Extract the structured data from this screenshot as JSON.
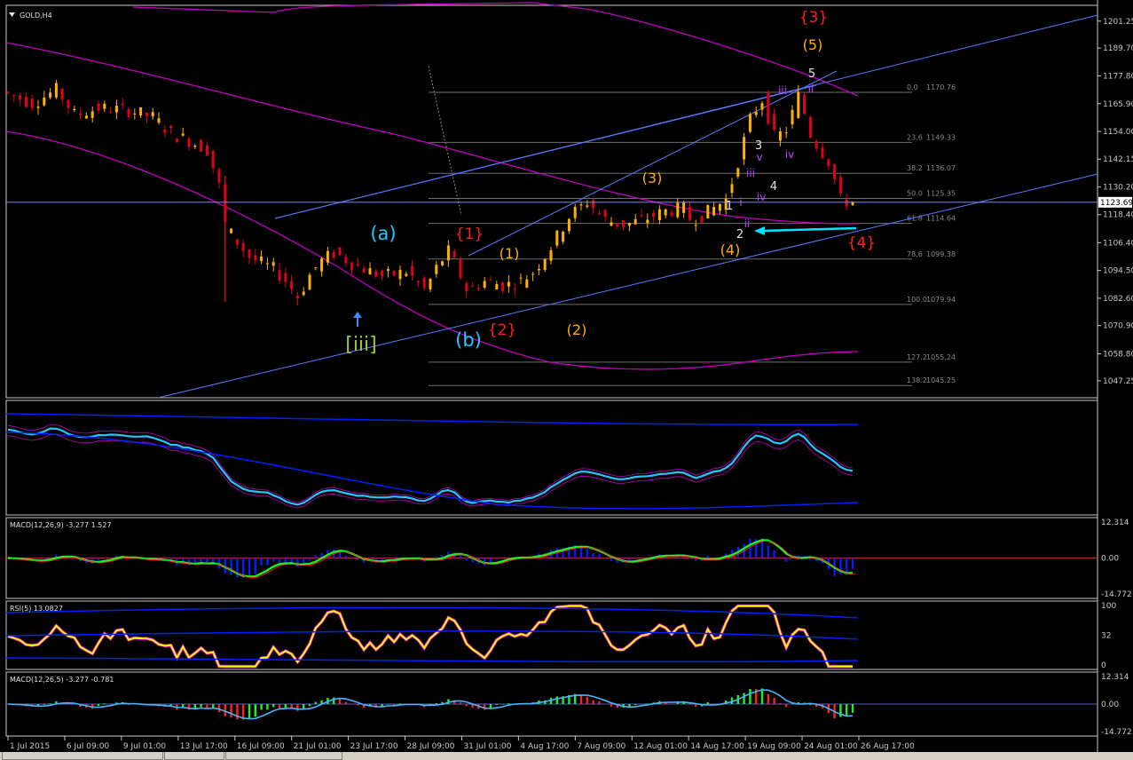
{
  "symbol_label": "GOLD,H4",
  "colors": {
    "background": "#000000",
    "frame": "#c8c8c8",
    "bull": "#ffb000",
    "bear": "#e0001a",
    "ma": "#c000c0",
    "trendline": "#5a78ff",
    "fib": "#6e6e6e",
    "macd_hist": "#0020ff",
    "macd_main": "#22ee22",
    "macd_signal": "#ff2020",
    "rsi_main": "#ffff00",
    "rsi_glow": "#ff00ff",
    "cyan": "#22c8ff",
    "arrow_cyan": "#00e5ff"
  },
  "chart_data": {
    "type": "candlestick",
    "instrument": "GOLD",
    "timeframe": "H4",
    "ylim": [
      1040,
      1208
    ],
    "y_ticks": [
      "1201.25",
      "1189.70",
      "1177.80",
      "1165.90",
      "1154.00",
      "1142.15",
      "1130.20",
      "1118.40",
      "1106.40",
      "1094.50",
      "1082.60",
      "1070.90",
      "1058.80",
      "1047.25"
    ],
    "current_price": "1123.69",
    "x_ticks": [
      "1 Jul 2015",
      "6 Jul 09:00",
      "9 Jul 01:00",
      "13 Jul 17:00",
      "16 Jul 09:00",
      "21 Jul 01:00",
      "23 Jul 17:00",
      "28 Jul 09:00",
      "31 Jul 01:00",
      "4 Aug 17:00",
      "7 Aug 09:00",
      "12 Aug 01:00",
      "14 Aug 17:00",
      "19 Aug 09:00",
      "24 Aug 01:00",
      "26 Aug 17:00"
    ],
    "price_path": [
      [
        0,
        1171
      ],
      [
        5,
        1166
      ],
      [
        9,
        1172
      ],
      [
        12,
        1161
      ],
      [
        16,
        1164
      ],
      [
        21,
        1163
      ],
      [
        25,
        1160
      ],
      [
        28,
        1153
      ],
      [
        31,
        1150
      ],
      [
        34,
        1146
      ],
      [
        36,
        1130
      ],
      [
        37,
        1113
      ],
      [
        41,
        1100
      ],
      [
        45,
        1095
      ],
      [
        47,
        1090
      ],
      [
        49,
        1083
      ],
      [
        51,
        1093
      ],
      [
        53,
        1099
      ],
      [
        55,
        1102
      ],
      [
        59,
        1096
      ],
      [
        63,
        1092
      ],
      [
        67,
        1094
      ],
      [
        70,
        1086
      ],
      [
        72,
        1096
      ],
      [
        74,
        1103
      ],
      [
        77,
        1086
      ],
      [
        80,
        1090
      ],
      [
        83,
        1088
      ],
      [
        86,
        1090
      ],
      [
        88,
        1094
      ],
      [
        91,
        1105
      ],
      [
        94,
        1118
      ],
      [
        97,
        1124
      ],
      [
        100,
        1116
      ],
      [
        103,
        1114
      ],
      [
        106,
        1116
      ],
      [
        110,
        1120
      ],
      [
        113,
        1121
      ],
      [
        114,
        1116
      ],
      [
        116,
        1118
      ],
      [
        120,
        1125
      ],
      [
        122,
        1142
      ],
      [
        124,
        1160
      ],
      [
        126,
        1168
      ],
      [
        128,
        1151
      ],
      [
        130,
        1155
      ],
      [
        132,
        1170
      ],
      [
        134,
        1152
      ],
      [
        137,
        1141
      ],
      [
        139,
        1124
      ]
    ],
    "fib_levels": [
      {
        "pct": "0.0",
        "price": "1170.76"
      },
      {
        "pct": "23.6",
        "price": "1149.33"
      },
      {
        "pct": "38.2",
        "price": "1136.07"
      },
      {
        "pct": "50.0",
        "price": "1125.35"
      },
      {
        "pct": "61.8",
        "price": "1114.64"
      },
      {
        "pct": "78.6",
        "price": "1099.38"
      },
      {
        "pct": "100.0",
        "price": "1079.94"
      },
      {
        "pct": "127.2",
        "price": "1055.24"
      },
      {
        "pct": "138.2",
        "price": "1045.25"
      }
    ],
    "wave_labels": [
      {
        "text": "[iii]",
        "color": "#9acd32",
        "size": 22
      },
      {
        "text": "(a)",
        "color": "#22c8ff",
        "size": 21
      },
      {
        "text": "(b)",
        "color": "#22c8ff",
        "size": 21
      },
      {
        "text": "{1}",
        "color": "#ff2020",
        "size": 17
      },
      {
        "text": "{2}",
        "color": "#ff2020",
        "size": 17
      },
      {
        "text": "{3}",
        "color": "#ff2020",
        "size": 17
      },
      {
        "text": "{4}",
        "color": "#ff2020",
        "size": 17
      },
      {
        "text": "(1)",
        "color": "#ffb000",
        "size": 16
      },
      {
        "text": "(2)",
        "color": "#ffb000",
        "size": 16
      },
      {
        "text": "(3)",
        "color": "#ffb000",
        "size": 16
      },
      {
        "text": "(4)",
        "color": "#ffb000",
        "size": 16
      },
      {
        "text": "(5)",
        "color": "#ffb000",
        "size": 16
      },
      {
        "text": "1",
        "color": "#e6e6e6",
        "size": 13
      },
      {
        "text": "2",
        "color": "#e6e6e6",
        "size": 13
      },
      {
        "text": "3",
        "color": "#e6e6e6",
        "size": 13
      },
      {
        "text": "4",
        "color": "#e6e6e6",
        "size": 13
      },
      {
        "text": "5",
        "color": "#e6e6e6",
        "size": 13
      },
      {
        "text": "i",
        "color": "#c040ff",
        "size": 12
      },
      {
        "text": "ii",
        "color": "#c040ff",
        "size": 12
      },
      {
        "text": "iii",
        "color": "#c040ff",
        "size": 12
      },
      {
        "text": "iv",
        "color": "#c040ff",
        "size": 12
      },
      {
        "text": "v",
        "color": "#c040ff",
        "size": 12
      },
      {
        "text": "iii",
        "color": "#c040ff",
        "size": 12
      },
      {
        "text": "iv",
        "color": "#c040ff",
        "size": 12
      },
      {
        "text": "ii",
        "color": "#c040ff",
        "size": 12
      }
    ],
    "panes": [
      {
        "title": "",
        "ticks": []
      },
      {
        "title": "MACD(12,26,9) -3.277 1.527",
        "ticks": [
          "12.314",
          "0.00",
          "-14.772"
        ]
      },
      {
        "title": "RSI(5) 13.0827",
        "ticks": [
          "100",
          "32",
          "0"
        ]
      },
      {
        "title": "MACD(12,26,5) -3.277 -0.781",
        "ticks": [
          "12.314",
          "0.00",
          "-14.772"
        ]
      }
    ]
  }
}
